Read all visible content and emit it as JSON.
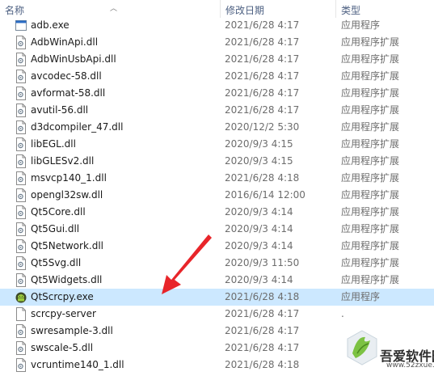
{
  "columns": {
    "name": "名称",
    "date": "修改日期",
    "type": "类型"
  },
  "files": [
    {
      "name": "adb.exe",
      "date": "2021/6/28 4:17",
      "type": "应用程序",
      "icon": "exe-file-icon"
    },
    {
      "name": "AdbWinApi.dll",
      "date": "2021/6/28 4:17",
      "type": "应用程序扩展",
      "icon": "dll-file-icon"
    },
    {
      "name": "AdbWinUsbApi.dll",
      "date": "2021/6/28 4:17",
      "type": "应用程序扩展",
      "icon": "dll-file-icon"
    },
    {
      "name": "avcodec-58.dll",
      "date": "2021/6/28 4:17",
      "type": "应用程序扩展",
      "icon": "dll-file-icon"
    },
    {
      "name": "avformat-58.dll",
      "date": "2021/6/28 4:17",
      "type": "应用程序扩展",
      "icon": "dll-file-icon"
    },
    {
      "name": "avutil-56.dll",
      "date": "2021/6/28 4:17",
      "type": "应用程序扩展",
      "icon": "dll-file-icon"
    },
    {
      "name": "d3dcompiler_47.dll",
      "date": "2020/12/2 5:30",
      "type": "应用程序扩展",
      "icon": "dll-file-icon"
    },
    {
      "name": "libEGL.dll",
      "date": "2020/9/3 4:15",
      "type": "应用程序扩展",
      "icon": "dll-file-icon"
    },
    {
      "name": "libGLESv2.dll",
      "date": "2020/9/3 4:15",
      "type": "应用程序扩展",
      "icon": "dll-file-icon"
    },
    {
      "name": "msvcp140_1.dll",
      "date": "2021/6/28 4:18",
      "type": "应用程序扩展",
      "icon": "dll-file-icon"
    },
    {
      "name": "opengl32sw.dll",
      "date": "2016/6/14 12:00",
      "type": "应用程序扩展",
      "icon": "dll-file-icon"
    },
    {
      "name": "Qt5Core.dll",
      "date": "2020/9/3 4:14",
      "type": "应用程序扩展",
      "icon": "dll-file-icon"
    },
    {
      "name": "Qt5Gui.dll",
      "date": "2020/9/3 4:14",
      "type": "应用程序扩展",
      "icon": "dll-file-icon"
    },
    {
      "name": "Qt5Network.dll",
      "date": "2020/9/3 4:14",
      "type": "应用程序扩展",
      "icon": "dll-file-icon"
    },
    {
      "name": "Qt5Svg.dll",
      "date": "2020/9/3 11:50",
      "type": "应用程序扩展",
      "icon": "dll-file-icon"
    },
    {
      "name": "Qt5Widgets.dll",
      "date": "2020/9/3 4:14",
      "type": "应用程序扩展",
      "icon": "dll-file-icon"
    },
    {
      "name": "QtScrcpy.exe",
      "date": "2021/6/28 4:18",
      "type": "应用程序",
      "icon": "android-app-icon",
      "selected": true
    },
    {
      "name": "scrcpy-server",
      "date": "2021/6/28 4:17",
      "type": ".",
      "icon": "blank-file-icon"
    },
    {
      "name": "swresample-3.dll",
      "date": "2021/6/28 4:17",
      "type": "",
      "icon": "dll-file-icon"
    },
    {
      "name": "swscale-5.dll",
      "date": "2021/6/28 4:17",
      "type": "",
      "icon": "dll-file-icon"
    },
    {
      "name": "vcruntime140_1.dll",
      "date": "2021/6/28 4:18",
      "type": "",
      "icon": "dll-file-icon"
    }
  ],
  "watermark": {
    "title": "吾爱软件园",
    "url": "www.52zxue.com"
  },
  "colors": {
    "selected_row": "#cce8ff",
    "arrow": "#e8252a",
    "header_text": "#4d6082"
  }
}
